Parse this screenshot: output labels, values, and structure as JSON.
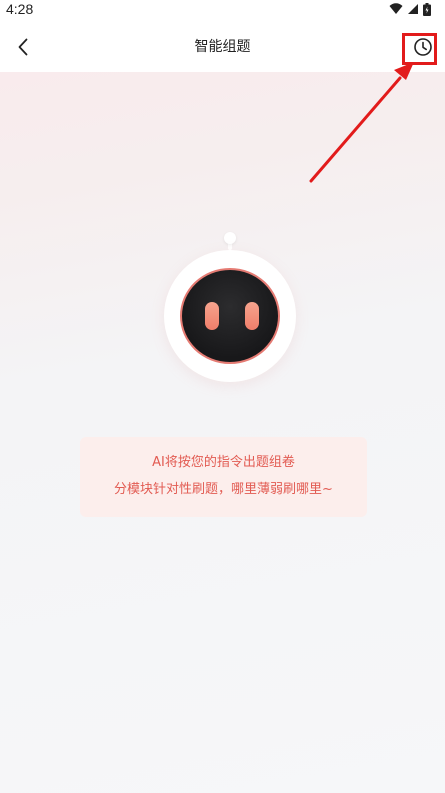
{
  "status_bar": {
    "time": "4:28",
    "icons": [
      "wifi-icon",
      "signal-icon",
      "battery-icon"
    ]
  },
  "nav": {
    "title": "智能组题",
    "back_icon": "chevron-left-icon",
    "history_icon": "clock-icon"
  },
  "message": {
    "line1": "AI将按您的指令出题组卷",
    "line2": "分模块针对性刷题，哪里薄弱刷哪里~"
  },
  "colors": {
    "annotation": "#e21b1b",
    "message_text": "#e25b52",
    "message_bg": "#fceeec",
    "robot_eye": "#f07e6a"
  }
}
